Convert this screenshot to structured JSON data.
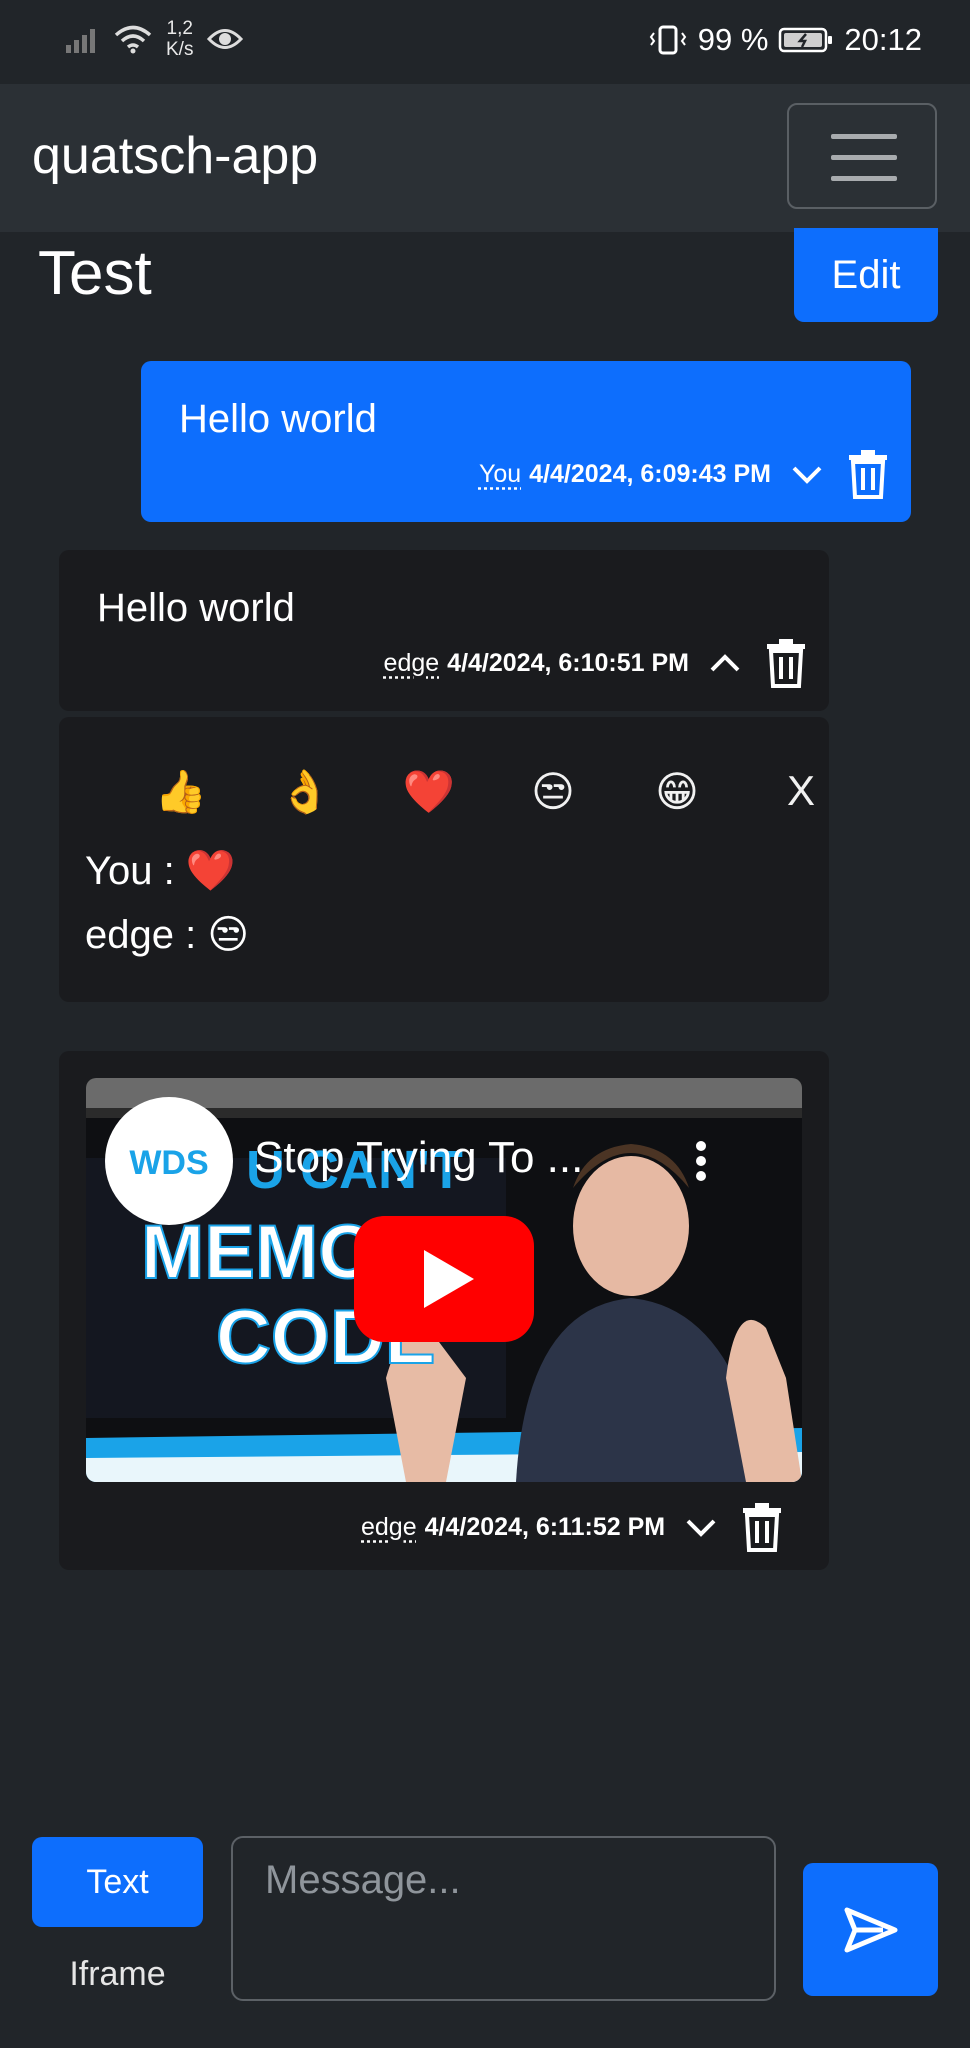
{
  "status_bar": {
    "net_speed_value": "1,2",
    "net_speed_unit": "K/s",
    "battery": "99 %",
    "time": "20:12"
  },
  "navbar": {
    "brand": "quatsch-app"
  },
  "page": {
    "title": "Test",
    "edit_label": "Edit"
  },
  "messages": [
    {
      "text": "Hello world",
      "author": "You",
      "timestamp": "4/4/2024, 6:09:43 PM"
    },
    {
      "text": "Hello world",
      "author": "edge",
      "timestamp": "4/4/2024, 6:10:51 PM"
    },
    {
      "author": "edge",
      "timestamp": "4/4/2024, 6:11:52 PM",
      "video_title": "Stop Trying To ..."
    }
  ],
  "reactions": {
    "options": [
      "👍",
      "👌",
      "❤️",
      "😒",
      "😁",
      "X"
    ],
    "list": [
      {
        "user": "You :",
        "emoji": "❤️"
      },
      {
        "user": "edge :",
        "emoji": "😒"
      }
    ]
  },
  "video": {
    "channel": "WDS",
    "thumb_text": [
      "U CAN'T",
      "MEMORI",
      "CODE"
    ]
  },
  "composer": {
    "tab_text": "Text",
    "tab_iframe": "Iframe",
    "placeholder": "Message..."
  },
  "colors": {
    "accent": "#0d6efd",
    "background": "#212529",
    "navbar": "#2b3035",
    "card": "#1a1b1e"
  }
}
